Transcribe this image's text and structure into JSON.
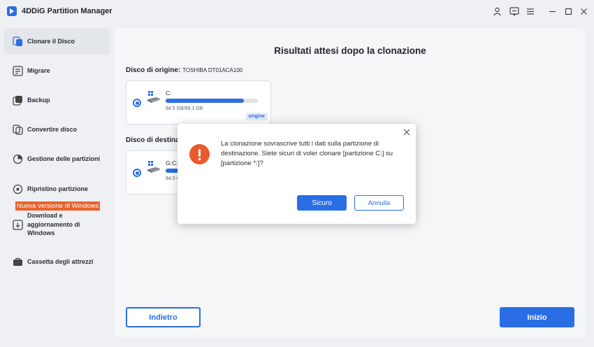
{
  "app": {
    "title": "4DDiG Partition Manager"
  },
  "sidebar": {
    "items": [
      {
        "label": "Clonare il Disco"
      },
      {
        "label": "Migrare"
      },
      {
        "label": "Backup"
      },
      {
        "label": "Convertire disco"
      },
      {
        "label": "Gestione delle partizioni"
      },
      {
        "label": "Ripristino partizione"
      },
      {
        "label": "Download e aggiornamento di Windows"
      },
      {
        "label": "Cassetta degli attrezzi"
      }
    ],
    "badge": "Nuova versione di Windows"
  },
  "main": {
    "title": "Risultati attesi dopo la clonazione",
    "source": {
      "label": "Disco di origine:",
      "disk_name": "TOSHIBA DT01ACA100",
      "partition": "C:",
      "size": "84.5 GB/99.1 GB",
      "usage": 0.85,
      "tag": "origine"
    },
    "destination": {
      "label": "Disco di destinazione:",
      "partition": "G:C:",
      "size": "84.5 GB/99.1 GB",
      "usage": 0.85
    },
    "back_label": "Indietro",
    "start_label": "Inizio"
  },
  "dialog": {
    "message": "La clonazione sovrascrive tutti i dati sulla partizione di destinazione. Siete sicuri di voler clonare [partizione C:] su [partizione *:]?",
    "ok_label": "Sicuro",
    "cancel_label": "Annulla"
  },
  "colors": {
    "accent": "#2a6ee6",
    "warning": "#ea5a2d",
    "badge": "#e9622b"
  }
}
